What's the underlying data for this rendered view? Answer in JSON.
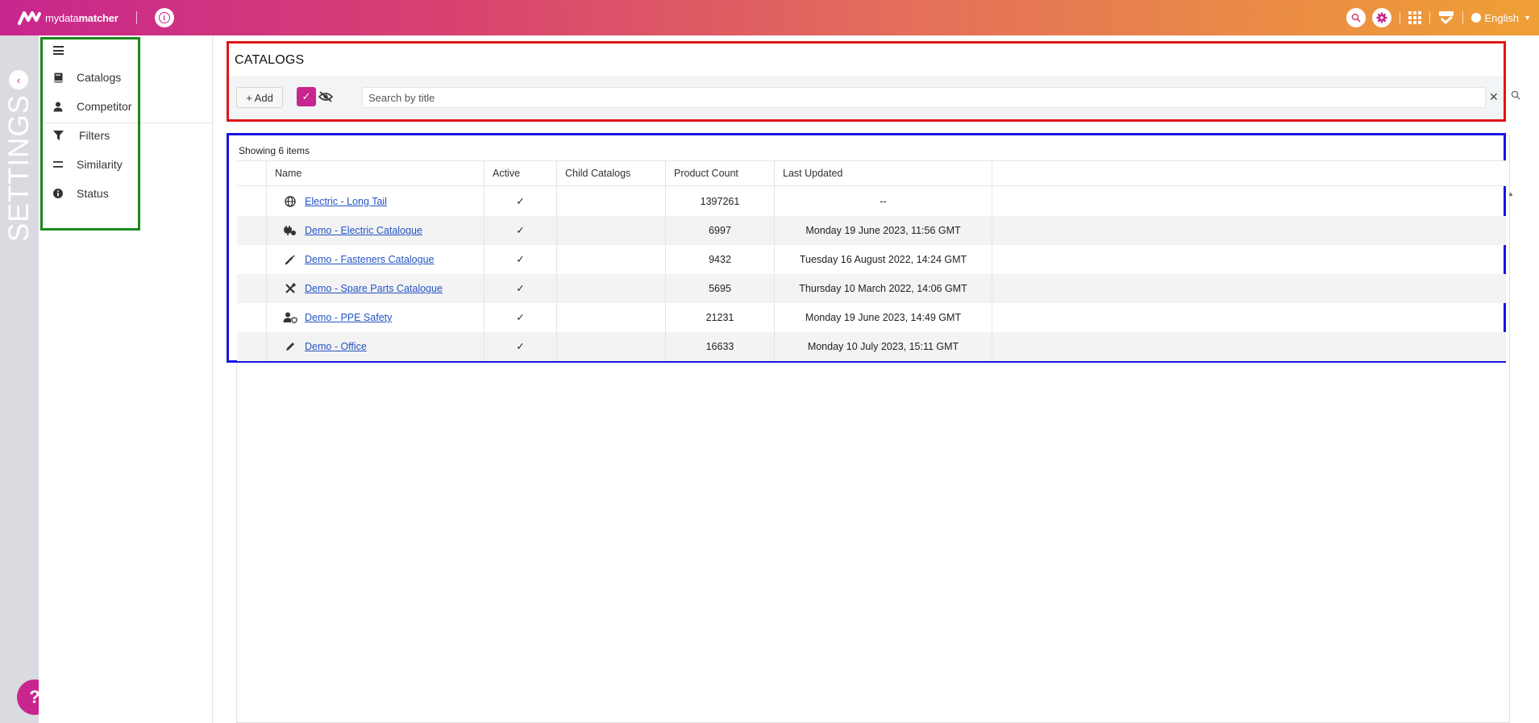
{
  "app": {
    "logo_text_light": "mydata",
    "logo_text_bold": "matcher",
    "language": "English"
  },
  "rail": {
    "label": "SETTINGS",
    "help": "?"
  },
  "menu": {
    "items": [
      {
        "label": "Catalogs",
        "icon": "book-icon"
      },
      {
        "label": "Competitor",
        "icon": "user-icon"
      },
      {
        "label": "Filters",
        "icon": "filter-icon"
      },
      {
        "label": "Similarity",
        "icon": "equals-icon"
      },
      {
        "label": "Status",
        "icon": "info-icon"
      }
    ]
  },
  "header": {
    "title": "CATALOGS",
    "add_label": "+ Add",
    "search_placeholder": "Search by title",
    "clear": "✕"
  },
  "table": {
    "showing": "Showing 6 items",
    "columns": [
      "Name",
      "Active",
      "Child Catalogs",
      "Product Count",
      "Last Updated"
    ],
    "rows": [
      {
        "icon": "globe-icon",
        "name": "Electric - Long Tail",
        "active": "✓",
        "child": "",
        "count": "1397261",
        "updated": "--"
      },
      {
        "icon": "plug-icon",
        "name": "Demo - Electric Catalogue",
        "active": "✓",
        "child": "",
        "count": "6997",
        "updated": "Monday 19 June 2023, 11:56 GMT"
      },
      {
        "icon": "screwdriver-icon",
        "name": "Demo - Fasteners Catalogue",
        "active": "✓",
        "child": "",
        "count": "9432",
        "updated": "Tuesday 16 August 2022, 14:24 GMT"
      },
      {
        "icon": "tools-icon",
        "name": "Demo - Spare Parts Catalogue",
        "active": "✓",
        "child": "",
        "count": "5695",
        "updated": "Thursday 10 March 2022, 14:06 GMT"
      },
      {
        "icon": "user-shield-icon",
        "name": "Demo - PPE Safety",
        "active": "✓",
        "child": "",
        "count": "21231",
        "updated": "Monday 19 June 2023, 14:49 GMT"
      },
      {
        "icon": "pencil-icon",
        "name": "Demo - Office",
        "active": "✓",
        "child": "",
        "count": "16633",
        "updated": "Monday 10 July 2023, 15:11 GMT"
      }
    ]
  },
  "colors": {
    "brand": "#c8268e",
    "link": "#2454c4"
  }
}
